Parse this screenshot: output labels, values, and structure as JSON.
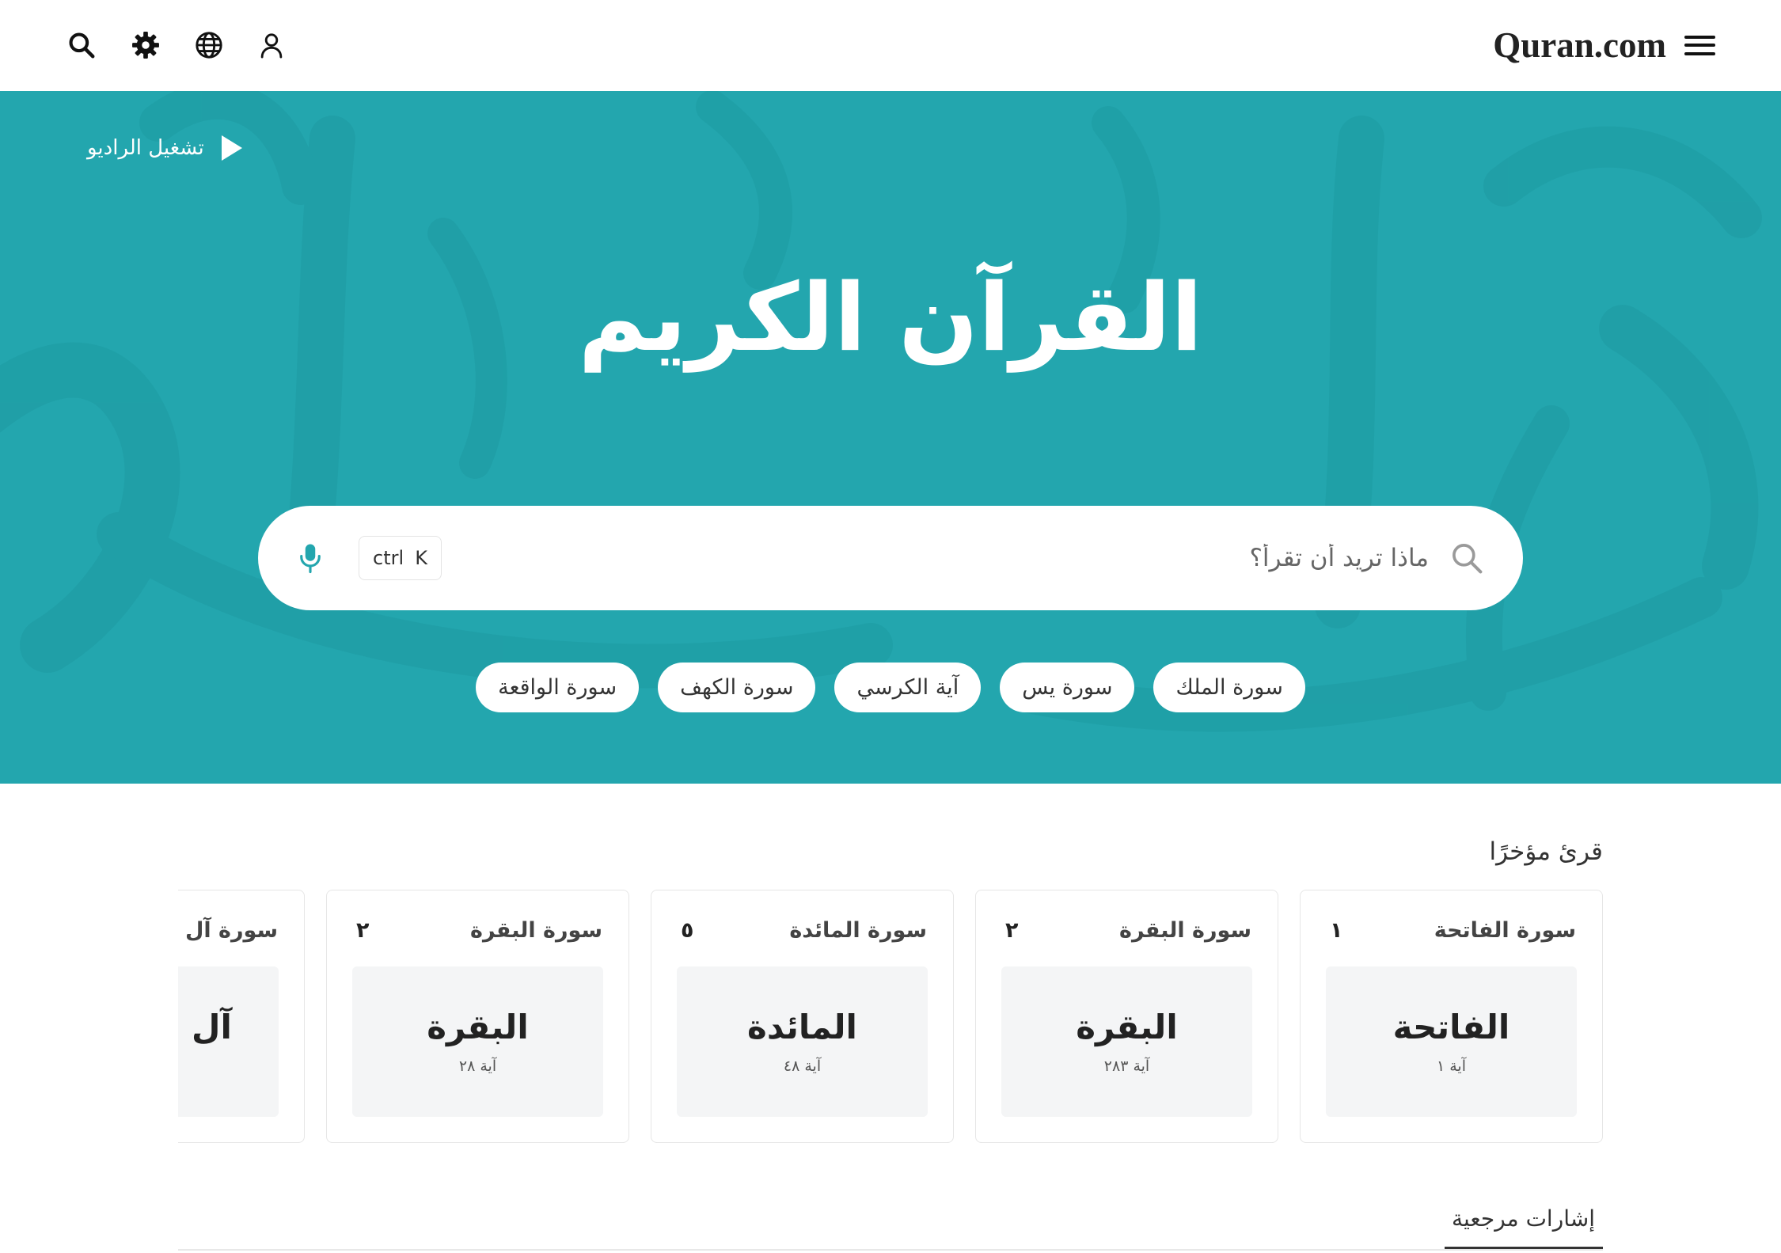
{
  "header": {
    "logo_text": "Quran.com",
    "icons": {
      "search": "search-icon",
      "settings": "gear-icon",
      "language": "globe-icon",
      "profile": "user-icon",
      "menu": "hamburger-menu-icon"
    }
  },
  "hero": {
    "radio_label": "تشغيل الراديو",
    "radio_icon": "play-icon",
    "title_calligraphy": "القرآن الكريم",
    "search": {
      "placeholder": "ماذا تريد أن تقرأ؟",
      "search_icon": "search-icon",
      "mic_icon": "microphone-icon",
      "shortcut": {
        "modifier": "ctrl",
        "key": "K"
      }
    },
    "chips": [
      "سورة الملك",
      "سورة يس",
      "آية الكرسي",
      "سورة الكهف",
      "سورة الواقعة"
    ]
  },
  "recently_read": {
    "heading": "قرئ مؤخرًا",
    "cards": [
      {
        "title": "سورة الفاتحة",
        "number": "١",
        "calligraphy": "الفاتحة",
        "ayah": "آية ١"
      },
      {
        "title": "سورة البقرة",
        "number": "٢",
        "calligraphy": "البقرة",
        "ayah": "آية ٢٨٣"
      },
      {
        "title": "سورة المائدة",
        "number": "٥",
        "calligraphy": "المائدة",
        "ayah": "آية ٤٨"
      },
      {
        "title": "سورة البقرة",
        "number": "٢",
        "calligraphy": "البقرة",
        "ayah": "آية ٢٨"
      },
      {
        "title": "سورة آل عمران",
        "calligraphy": "آل عمران"
      }
    ]
  },
  "tabs": {
    "bookmarks_label": "إشارات مرجعية"
  },
  "colors": {
    "brand_teal": "#23a6ae",
    "page_background": "#ffffff",
    "chip_background": "#ffffff",
    "card_preview_background": "#f4f5f6"
  }
}
